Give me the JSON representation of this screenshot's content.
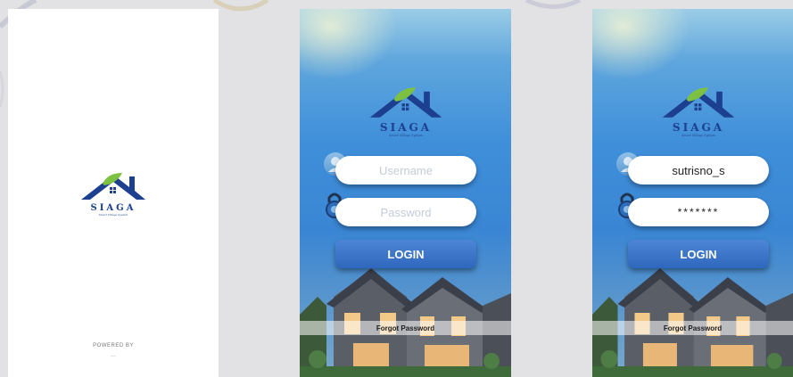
{
  "splash": {
    "logo_text": "SIAGA",
    "logo_tagline": "Smart Village System",
    "powered_by": "POWERED BY",
    "powered_sub": "..."
  },
  "login_empty": {
    "logo_text": "SIAGA",
    "logo_tagline": "Smart Village System",
    "username_placeholder": "Username",
    "password_placeholder": "Password",
    "login_label": "LOGIN",
    "forgot_label": "Forgot Password"
  },
  "login_filled": {
    "logo_text": "SIAGA",
    "logo_tagline": "Smart Village System",
    "username_value": "sutrisno_s",
    "password_value": "*******",
    "login_label": "LOGIN",
    "forgot_label": "Forgot Password"
  },
  "colors": {
    "brand_navy": "#1d3f8f",
    "leaf_green": "#7cc142",
    "button_blue": "#3a70c4",
    "sky_blue": "#3f8fda"
  },
  "icons": [
    "house-logo-icon",
    "leaf-icon",
    "user-icon",
    "lock-icon"
  ]
}
